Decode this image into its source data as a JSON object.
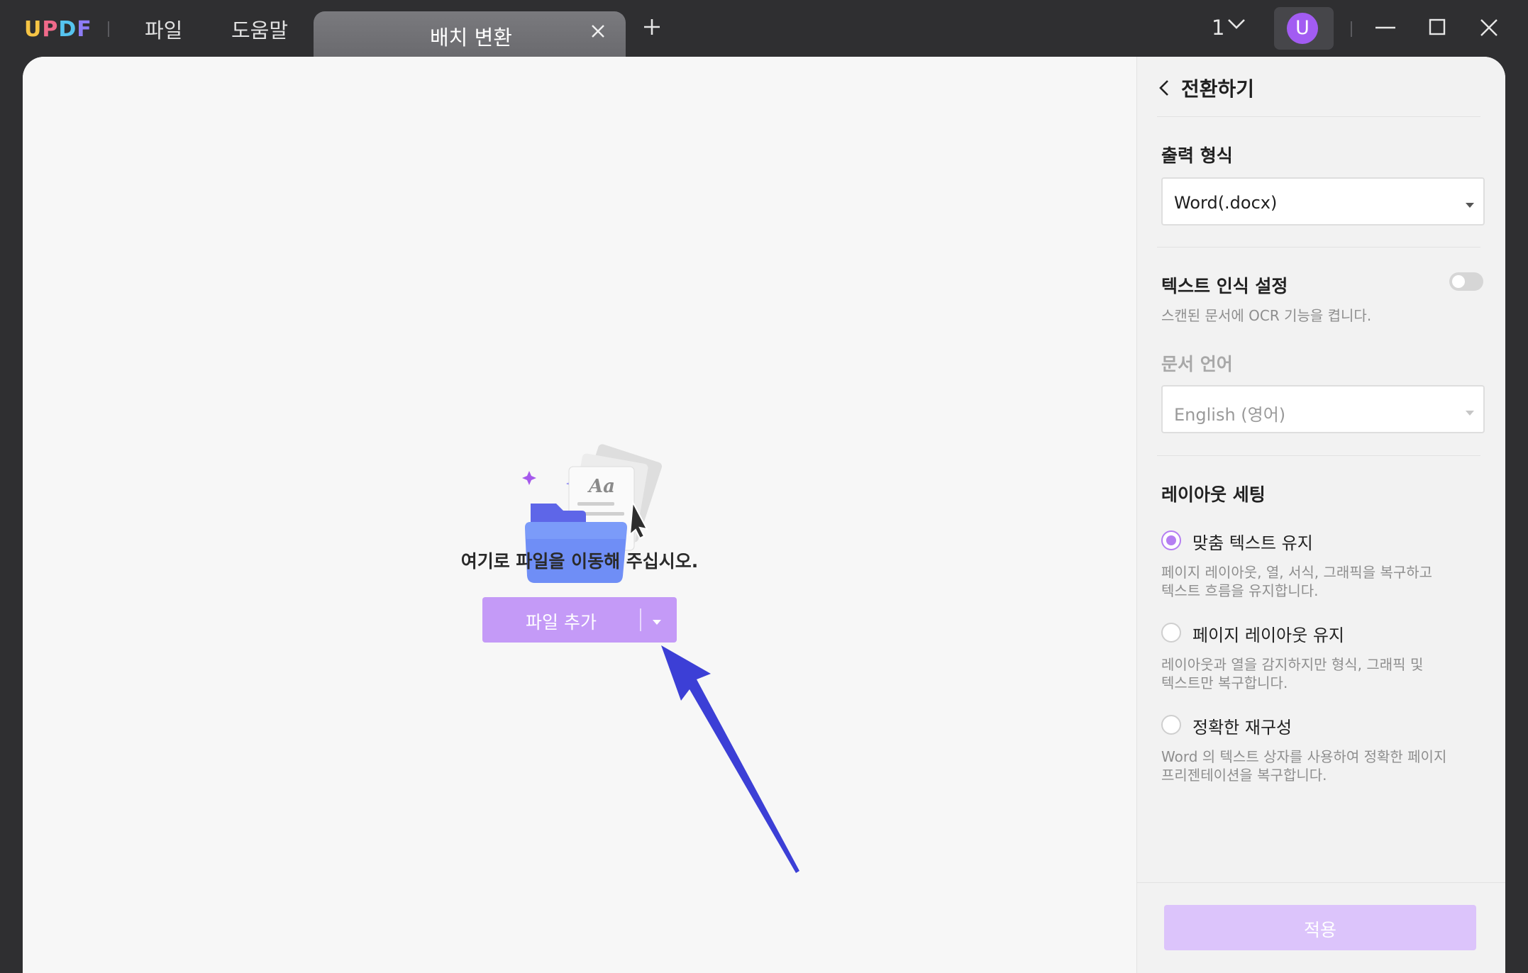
{
  "app": {
    "logo_text": "UPDF",
    "menu": [
      {
        "label": "파일"
      },
      {
        "label": "도움말"
      }
    ],
    "tab": {
      "label": "배치 변환"
    },
    "page_indicator": "1",
    "user_avatar_letter": "U"
  },
  "dropzone": {
    "instruction": "여기로 파일을 이동해 주십시오.",
    "add_button_label": "파일 추가",
    "illustration_text": "Aa"
  },
  "panel": {
    "title": "전환하기",
    "output_format": {
      "label": "출력 형식",
      "value": "Word(.docx)"
    },
    "ocr": {
      "label": "텍스트 인식 설정",
      "hint": "스캔된 문서에 OCR 기능을 켭니다.",
      "enabled": false
    },
    "document_language": {
      "label": "문서 언어",
      "value": "English (영어)"
    },
    "layout": {
      "label": "레이아웃 세팅",
      "options": [
        {
          "label": "맞춤 텍스트 유지",
          "hint": "페이지 레이아웃, 열, 서식, 그래픽을 복구하고\n텍스트 흐름을 유지합니다.",
          "selected": true
        },
        {
          "label": "페이지 레이아웃 유지",
          "hint": "레이아웃과 열을 감지하지만 형식, 그래픽 및\n텍스트만 복구합니다.",
          "selected": false
        },
        {
          "label": "정확한 재구성",
          "hint": "Word 의 텍스트 상자를 사용하여 정확한 페이지\n프리젠테이션을 복구합니다.",
          "selected": false
        }
      ]
    },
    "apply_label": "적용"
  },
  "colors": {
    "accent": "#b57ef2",
    "add_button": "#c49af7",
    "apply_button_disabled": "#dcc4fb",
    "avatar": "#a25cf2",
    "arrow_annotation": "#3c3fd6",
    "titlebar": "#2f2f31"
  }
}
